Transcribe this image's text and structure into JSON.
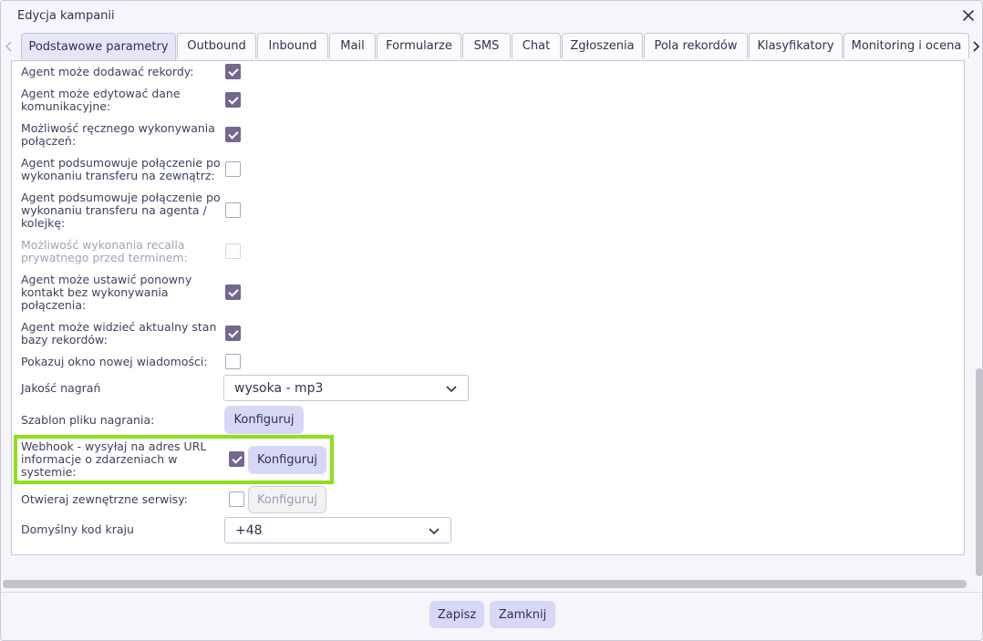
{
  "window": {
    "title": "Edycja kampanii"
  },
  "tabs": [
    {
      "label": "Podstawowe parametry",
      "active": true
    },
    {
      "label": "Outbound"
    },
    {
      "label": "Inbound"
    },
    {
      "label": "Mail"
    },
    {
      "label": "Formularze"
    },
    {
      "label": "SMS"
    },
    {
      "label": "Chat"
    },
    {
      "label": "Zgłoszenia"
    },
    {
      "label": "Pola rekordów"
    },
    {
      "label": "Klasyfikatory"
    },
    {
      "label": "Monitoring i ocena"
    }
  ],
  "settings": [
    {
      "label": "Agent może dodawać rekordy:",
      "checked": true
    },
    {
      "label": "Agent może edytować dane komunikacyjne:",
      "checked": true
    },
    {
      "label": "Możliwość ręcznego wykonywania połączeń:",
      "checked": true
    },
    {
      "label": "Agent podsumowuje połączenie po wykonaniu transferu na zewnątrz:",
      "checked": false
    },
    {
      "label": "Agent podsumowuje połączenie po wykonaniu transferu na agenta / kolejkę:",
      "checked": false
    },
    {
      "label": "Możliwość wykonania recalla prywatnego przed terminem:",
      "checked": false,
      "disabled": true
    },
    {
      "label": "Agent może ustawić ponowny kontakt bez wykonywania połączenia:",
      "checked": true
    },
    {
      "label": "Agent może widzieć aktualny stan bazy rekordów:",
      "checked": true
    },
    {
      "label": "Pokazuj okno nowej wiadomości:",
      "checked": false
    }
  ],
  "recording_quality": {
    "label": "Jakość nagrań",
    "value": "wysoka - mp3"
  },
  "recording_template": {
    "label": "Szablon pliku nagrania:",
    "button": "Konfiguruj"
  },
  "webhook": {
    "label": "Webhook - wysyłaj na adres URL informacje o zdarzeniach w systemie:",
    "checked": true,
    "button": "Konfiguruj",
    "highlight_color": "#8ee01b"
  },
  "external_services": {
    "label": "Otwieraj zewnętrzne serwisy:",
    "checked": false,
    "button": "Konfiguruj"
  },
  "country_code": {
    "label": "Domyślny kod kraju",
    "value": "+48"
  },
  "footer": {
    "save": "Zapisz",
    "close": "Zamknij"
  },
  "colors": {
    "accent": "#74688f",
    "button_bg": "#d7d7f6",
    "tab_active_bg": "#e6e6f7"
  }
}
